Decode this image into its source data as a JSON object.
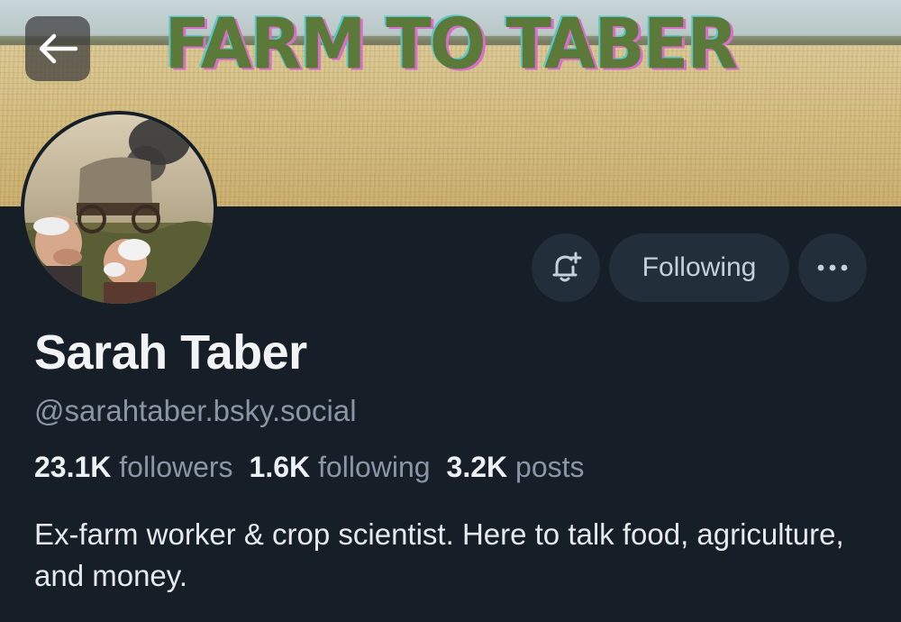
{
  "banner": {
    "title": "FARM TO TABER",
    "back_icon": "arrow-left-icon"
  },
  "profile": {
    "display_name": "Sarah Taber",
    "handle": "@sarahtaber.bsky.social",
    "bio": "Ex-farm worker & crop scientist. Here to talk food, agriculture, and money."
  },
  "stats": {
    "followers_count": "23.1K",
    "followers_label": "followers",
    "following_count": "1.6K",
    "following_label": "following",
    "posts_count": "3.2K",
    "posts_label": "posts"
  },
  "actions": {
    "subscribe_icon": "bell-plus-icon",
    "following_label": "Following",
    "more_icon": "ellipsis-icon"
  },
  "colors": {
    "background": "#161e27",
    "button_bg": "#232e3b",
    "muted_text": "#8a96a6",
    "primary_text": "#f1f3f5"
  }
}
